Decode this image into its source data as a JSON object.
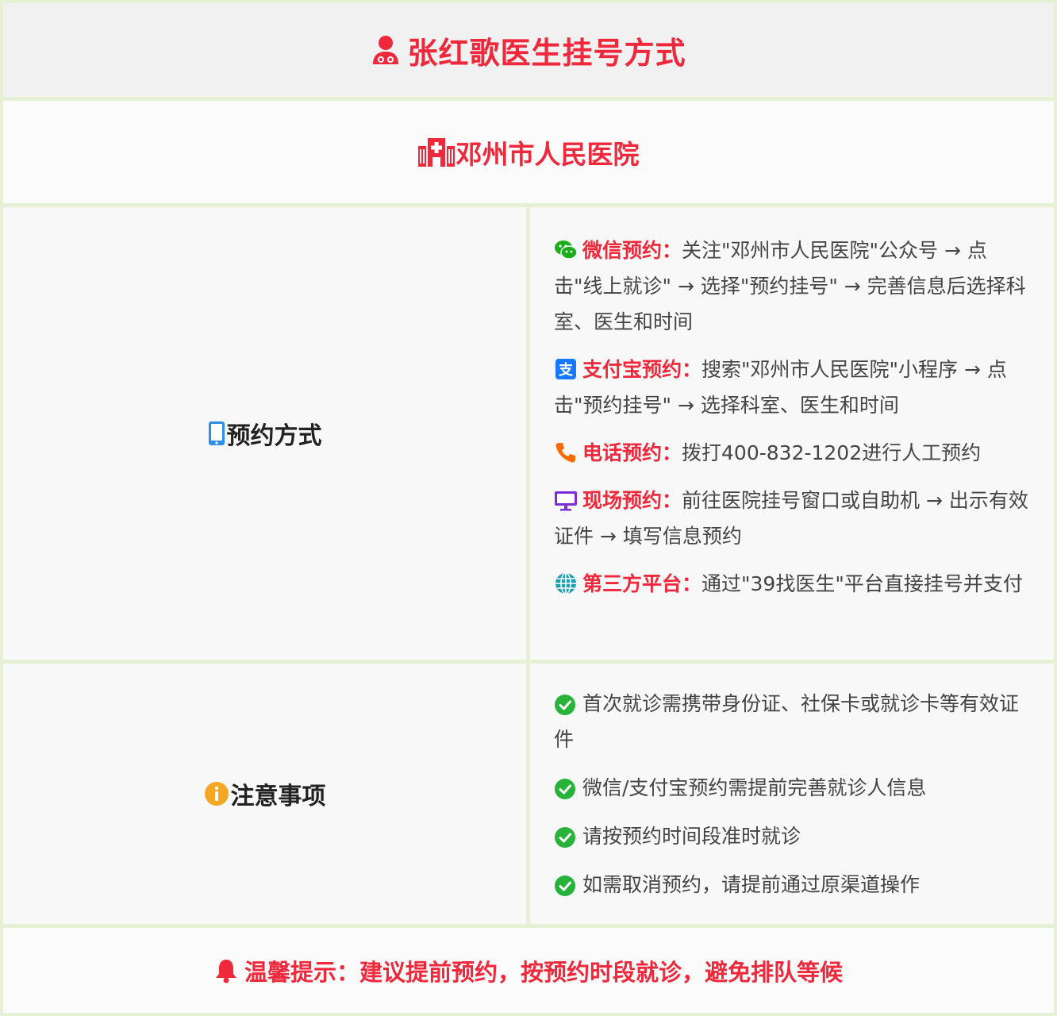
{
  "header": {
    "title": "张红歌医生挂号方式"
  },
  "hospital": {
    "name": "邓州市人民医院"
  },
  "booking": {
    "label": "预约方式",
    "methods": [
      {
        "name": "微信预约：",
        "text": "关注\"邓州市人民医院\"公众号 → 点击\"线上就诊\" → 选择\"预约挂号\" → 完善信息后选择科室、医生和时间",
        "icon": "wechat-icon"
      },
      {
        "name": "支付宝预约：",
        "text": "搜索\"邓州市人民医院\"小程序 → 点击\"预约挂号\" → 选择科室、医生和时间",
        "icon": "alipay-icon"
      },
      {
        "name": "电话预约：",
        "text": "拨打400-832-1202进行人工预约",
        "icon": "phone-icon"
      },
      {
        "name": "现场预约：",
        "text": "前往医院挂号窗口或自助机 → 出示有效证件 → 填写信息预约",
        "icon": "monitor-icon"
      },
      {
        "name": "第三方平台：",
        "text": "通过\"39找医生\"平台直接挂号并支付",
        "icon": "globe-icon"
      }
    ]
  },
  "notes": {
    "label": "注意事项",
    "items": [
      "首次就诊需携带身份证、社保卡或就诊卡等有效证件",
      "微信/支付宝预约需提前完善就诊人信息",
      "请按预约时间段准时就诊",
      "如需取消预约，请提前通过原渠道操作"
    ]
  },
  "tip": {
    "text": "温馨提示：建议提前预约，按预约时段就诊，避免排队等候"
  },
  "colors": {
    "accent": "#f0283c",
    "wechat": "#1aad19",
    "alipay": "#1678ff",
    "phone": "#ff6a00",
    "monitor": "#7b2fd6",
    "globe": "#1aa0b0",
    "check": "#27b33a",
    "info": "#f5a623",
    "mobile": "#2f8fe8"
  }
}
